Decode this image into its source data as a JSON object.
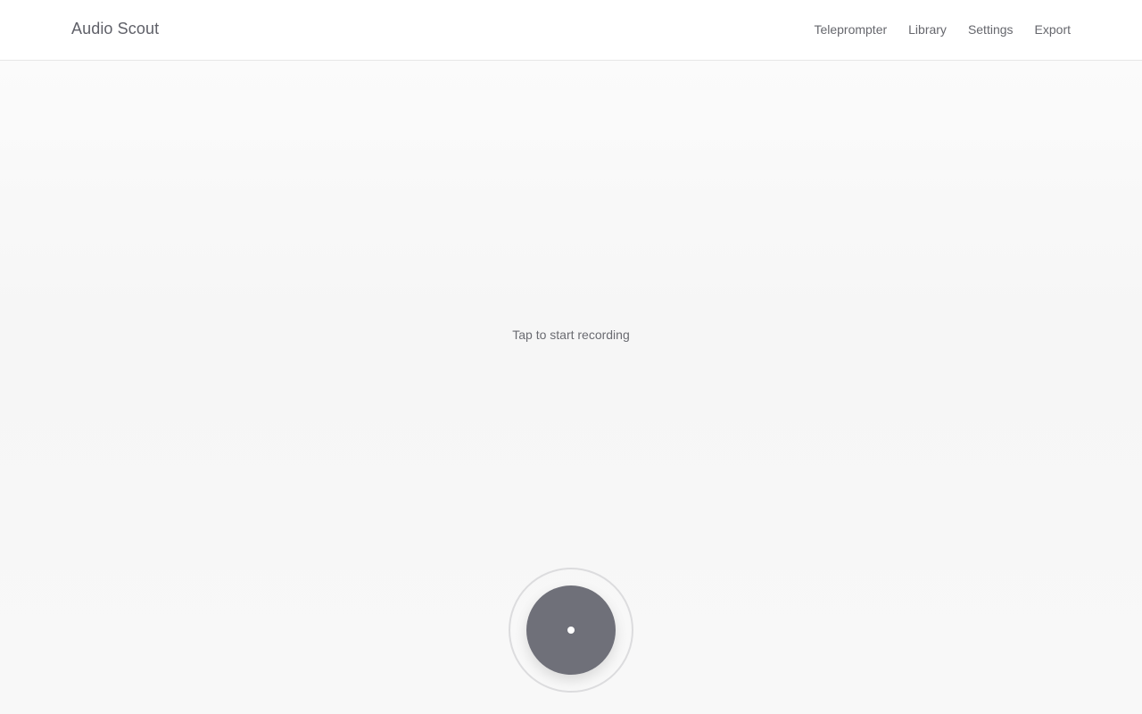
{
  "app": {
    "title": "Audio Scout"
  },
  "nav": {
    "items": [
      {
        "label": "Teleprompter"
      },
      {
        "label": "Library"
      },
      {
        "label": "Settings"
      },
      {
        "label": "Export"
      }
    ]
  },
  "main": {
    "prompt": "Tap to start recording",
    "record_button": {
      "icon": "record-dot-icon",
      "color": "#6f7079"
    }
  }
}
